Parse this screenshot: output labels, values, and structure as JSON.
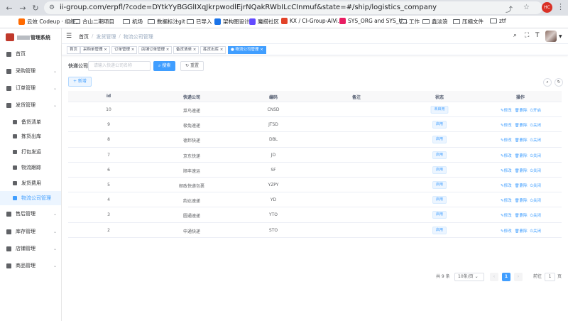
{
  "browser": {
    "url": "ii-group.com/erpfl/?code=DYtkYyBGGlIXqJkrpwodlEjrNQakRWbILcCInmuf&state=#/ship/logistics_company",
    "bookmarks": [
      "云效 Codeup · 组织...",
      "合山二期项目",
      "机场",
      "数据标注git",
      "已导入",
      "架构图设计",
      "魔搭社区",
      "KX / CI-Group-AIVi...",
      "SYS_ORG and SYS_U...",
      "工作",
      "鑫淡浪",
      "压缩文件",
      "ztf"
    ],
    "avatar_text": "HC"
  },
  "sidebar": {
    "system_name": "管理系统",
    "items": [
      {
        "label": "首页",
        "arrow": false,
        "sub": false,
        "active": false
      },
      {
        "label": "采购管理",
        "arrow": true,
        "sub": false,
        "active": false
      },
      {
        "label": "订单管理",
        "arrow": true,
        "sub": false,
        "active": false
      },
      {
        "label": "发货管理",
        "arrow": true,
        "sub": false,
        "active": false
      },
      {
        "label": "备货清单",
        "arrow": false,
        "sub": true,
        "active": false
      },
      {
        "label": "拣货出库",
        "arrow": false,
        "sub": true,
        "active": false
      },
      {
        "label": "打包发运",
        "arrow": false,
        "sub": true,
        "active": false
      },
      {
        "label": "物流跟踪",
        "arrow": false,
        "sub": true,
        "active": false
      },
      {
        "label": "发货费用",
        "arrow": false,
        "sub": true,
        "active": false
      },
      {
        "label": "物流公司管理",
        "arrow": false,
        "sub": true,
        "active": true
      },
      {
        "label": "售后管理",
        "arrow": true,
        "sub": false,
        "active": false
      },
      {
        "label": "库存管理",
        "arrow": true,
        "sub": false,
        "active": false
      },
      {
        "label": "店铺管理",
        "arrow": true,
        "sub": false,
        "active": false
      },
      {
        "label": "商品管理",
        "arrow": true,
        "sub": false,
        "active": false
      }
    ]
  },
  "header": {
    "breadcrumb": [
      "首页",
      "发货管理",
      "物流公司管理"
    ]
  },
  "tags": [
    "首页",
    "采购单管理 ×",
    "订单管理 ×",
    "店铺订单管理 ×",
    "备货清单 ×",
    "拣货出库 ×",
    "● 物流公司管理 ×"
  ],
  "search": {
    "label": "快递公司",
    "placeholder": "请输入快递公司名称",
    "search_button": "搜索",
    "reset_button": "重置",
    "add_button": "+ 新增"
  },
  "table": {
    "columns": [
      "id",
      "快递公司",
      "编码",
      "备注",
      "状态",
      "操作"
    ],
    "rows": [
      {
        "id": "10",
        "company": "菜鸟速递",
        "code": "CNSD",
        "note": "",
        "status": "未启用",
        "actions": [
          "修改",
          "删除",
          "开启"
        ]
      },
      {
        "id": "9",
        "company": "极兔速递",
        "code": "JTSD",
        "note": "",
        "status": "启用",
        "actions": [
          "修改",
          "删除",
          "关闭"
        ]
      },
      {
        "id": "8",
        "company": "德邦快递",
        "code": "DBL",
        "note": "",
        "status": "启用",
        "actions": [
          "修改",
          "删除",
          "关闭"
        ]
      },
      {
        "id": "7",
        "company": "京东快递",
        "code": "JD",
        "note": "",
        "status": "启用",
        "actions": [
          "修改",
          "删除",
          "关闭"
        ]
      },
      {
        "id": "6",
        "company": "顺丰速运",
        "code": "SF",
        "note": "",
        "status": "启用",
        "actions": [
          "修改",
          "删除",
          "关闭"
        ]
      },
      {
        "id": "5",
        "company": "邮政快递包裹",
        "code": "YZPY",
        "note": "",
        "status": "启用",
        "actions": [
          "修改",
          "删除",
          "关闭"
        ]
      },
      {
        "id": "4",
        "company": "韵达速递",
        "code": "YD",
        "note": "",
        "status": "启用",
        "actions": [
          "修改",
          "删除",
          "关闭"
        ]
      },
      {
        "id": "3",
        "company": "圆通速递",
        "code": "YTO",
        "note": "",
        "status": "启用",
        "actions": [
          "修改",
          "删除",
          "关闭"
        ]
      },
      {
        "id": "2",
        "company": "申通快递",
        "code": "STO",
        "note": "",
        "status": "启用",
        "actions": [
          "修改",
          "删除",
          "关闭"
        ]
      }
    ]
  },
  "pagination": {
    "total": "共 9 条",
    "page_size": "10条/页",
    "current": "1",
    "goto_label": "前往",
    "goto_value": "1",
    "page_suffix": "页"
  }
}
